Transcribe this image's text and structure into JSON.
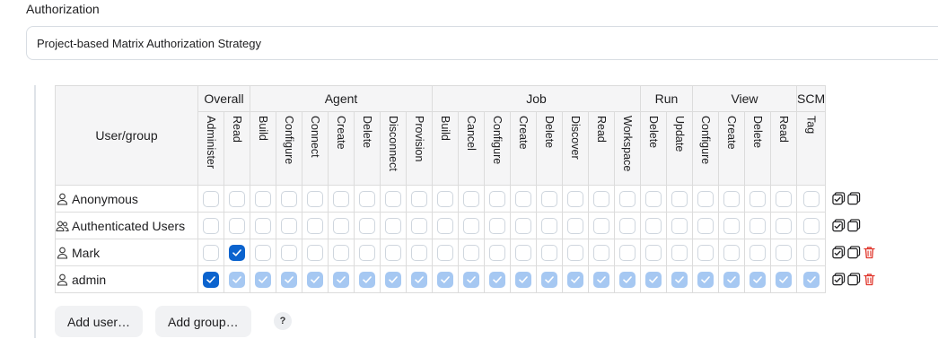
{
  "section": {
    "label": "Authorization",
    "strategy": "Project-based Matrix Authorization Strategy"
  },
  "matrix": {
    "corner_label": "User/group",
    "groups": [
      {
        "label": "Overall",
        "perms": [
          "Administer",
          "Read"
        ]
      },
      {
        "label": "Agent",
        "perms": [
          "Build",
          "Configure",
          "Connect",
          "Create",
          "Delete",
          "Disconnect",
          "Provision"
        ]
      },
      {
        "label": "Job",
        "perms": [
          "Build",
          "Cancel",
          "Configure",
          "Create",
          "Delete",
          "Discover",
          "Read",
          "Workspace"
        ]
      },
      {
        "label": "Run",
        "perms": [
          "Delete",
          "Update"
        ]
      },
      {
        "label": "View",
        "perms": [
          "Configure",
          "Create",
          "Delete",
          "Read"
        ]
      },
      {
        "label": "SCM",
        "perms": [
          "Tag"
        ]
      }
    ],
    "rows": [
      {
        "name": "Anonymous",
        "icon": "person-icon",
        "deletable": false,
        "states": [
          "off",
          "off",
          "off",
          "off",
          "off",
          "off",
          "off",
          "off",
          "off",
          "off",
          "off",
          "off",
          "off",
          "off",
          "off",
          "off",
          "off",
          "off",
          "off",
          "off",
          "off",
          "off",
          "off",
          "off"
        ]
      },
      {
        "name": "Authenticated Users",
        "icon": "people-icon",
        "deletable": false,
        "states": [
          "off",
          "off",
          "off",
          "off",
          "off",
          "off",
          "off",
          "off",
          "off",
          "off",
          "off",
          "off",
          "off",
          "off",
          "off",
          "off",
          "off",
          "off",
          "off",
          "off",
          "off",
          "off",
          "off",
          "off"
        ]
      },
      {
        "name": "Mark",
        "icon": "person-icon",
        "deletable": true,
        "states": [
          "off",
          "on",
          "off",
          "off",
          "off",
          "off",
          "off",
          "off",
          "off",
          "off",
          "off",
          "off",
          "off",
          "off",
          "off",
          "off",
          "off",
          "off",
          "off",
          "off",
          "off",
          "off",
          "off",
          "off"
        ]
      },
      {
        "name": "admin",
        "icon": "person-icon",
        "deletable": true,
        "states": [
          "on",
          "implied",
          "implied",
          "implied",
          "implied",
          "implied",
          "implied",
          "implied",
          "implied",
          "implied",
          "implied",
          "implied",
          "implied",
          "implied",
          "implied",
          "implied",
          "implied",
          "implied",
          "implied",
          "implied",
          "implied",
          "implied",
          "implied",
          "implied"
        ]
      }
    ]
  },
  "buttons": {
    "add_user": "Add user…",
    "add_group": "Add group…",
    "help": "?"
  },
  "colors": {
    "checked": "#0b63ce",
    "implied": "#a6c8f2",
    "delete": "#e0352b"
  }
}
